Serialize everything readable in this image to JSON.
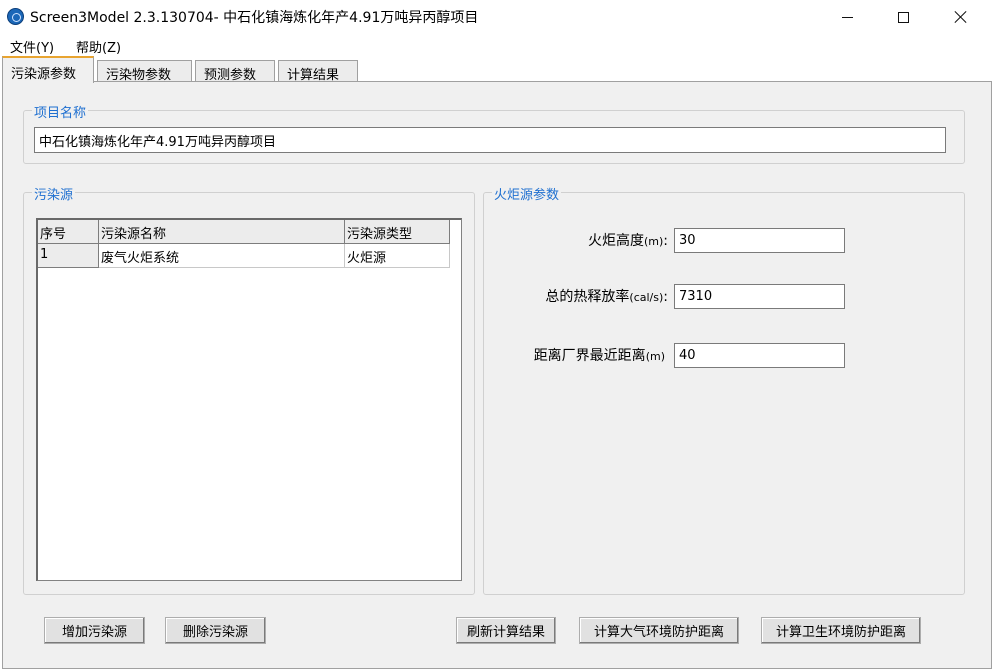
{
  "window": {
    "title": "Screen3Model 2.3.130704- 中石化镇海炼化年产4.91万吨异丙醇项目"
  },
  "menu": {
    "items": [
      {
        "label": "文件(Y)"
      },
      {
        "label": "帮助(Z)"
      }
    ]
  },
  "tabs": [
    {
      "label": "污染源参数",
      "active": true
    },
    {
      "label": "污染物参数",
      "active": false
    },
    {
      "label": "预测参数",
      "active": false
    },
    {
      "label": "计算结果",
      "active": false
    }
  ],
  "project": {
    "legend": "项目名称",
    "value": "中石化镇海炼化年产4.91万吨异丙醇项目"
  },
  "sources": {
    "legend": "污染源",
    "columns": [
      "序号",
      "污染源名称",
      "污染源类型"
    ],
    "rows": [
      {
        "index": "1",
        "name": "废气火炬系统",
        "type": "火炬源"
      }
    ]
  },
  "flare": {
    "legend": "火炬源参数",
    "fields": [
      {
        "label": "火炬高度",
        "unit": "(m)",
        "suffix": ":",
        "value": "30"
      },
      {
        "label": "总的热释放率",
        "unit": "(cal/s)",
        "suffix": ":",
        "value": "7310"
      },
      {
        "label": "距离厂界最近距离",
        "unit": "(m)",
        "suffix": "",
        "value": "40"
      }
    ]
  },
  "buttons": {
    "add": "增加污染源",
    "delete": "删除污染源",
    "refresh": "刷新计算结果",
    "atmos": "计算大气环境防护距离",
    "health": "计算卫生环境防护距离"
  },
  "colors": {
    "legend_text": "#1e6fd0",
    "active_tab_accent": "#e8a430",
    "panel_bg": "#f0f0f0"
  }
}
